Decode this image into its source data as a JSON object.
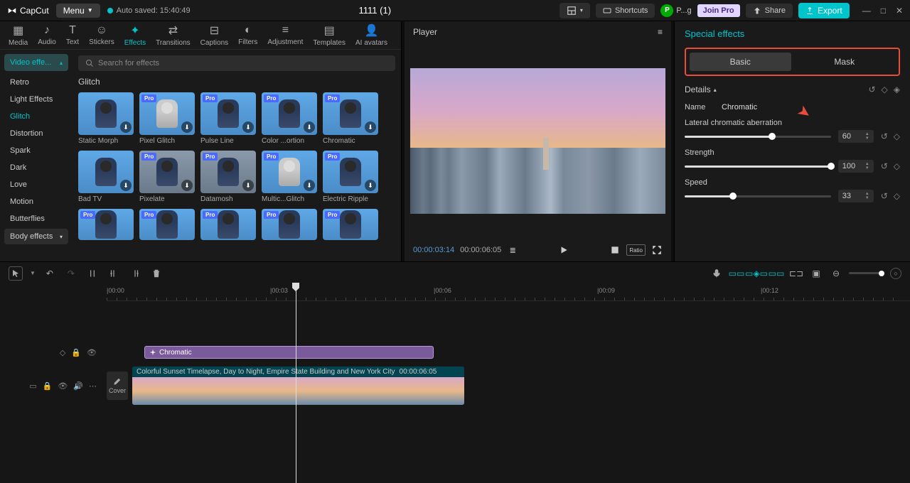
{
  "app": {
    "name": "CapCut",
    "menu": "Menu",
    "autosave": "Auto saved: 15:40:49",
    "project": "1111 (1)"
  },
  "top": {
    "shortcuts": "Shortcuts",
    "user": "P...g",
    "user_initial": "P",
    "join": "Join Pro",
    "share": "Share",
    "export": "Export"
  },
  "nav": [
    "Media",
    "Audio",
    "Text",
    "Stickers",
    "Effects",
    "Transitions",
    "Captions",
    "Filters",
    "Adjustment",
    "Templates",
    "AI avatars"
  ],
  "sidebar": {
    "header": "Video effe...",
    "items": [
      "Retro",
      "Light Effects",
      "Glitch",
      "Distortion",
      "Spark",
      "Dark",
      "Love",
      "Motion",
      "Butterflies"
    ],
    "active": "Glitch",
    "body": "Body effects"
  },
  "search": {
    "placeholder": "Search for effects"
  },
  "section": "Glitch",
  "effects": [
    {
      "label": "Static Morph",
      "pro": false
    },
    {
      "label": "Pixel Glitch",
      "pro": true
    },
    {
      "label": "Pulse Line",
      "pro": true
    },
    {
      "label": "Color ...ortion",
      "pro": true
    },
    {
      "label": "Chromatic",
      "pro": true
    },
    {
      "label": "Bad TV",
      "pro": false
    },
    {
      "label": "Pixelate",
      "pro": true
    },
    {
      "label": "Datamosh",
      "pro": true
    },
    {
      "label": "Multic...Glitch",
      "pro": true
    },
    {
      "label": "Electric Ripple",
      "pro": true
    }
  ],
  "player": {
    "title": "Player",
    "cur": "00:00:03:14",
    "dur": "00:00:06:05",
    "ratio": "Ratio"
  },
  "rp": {
    "title": "Special effects",
    "tabs": [
      "Basic",
      "Mask"
    ],
    "details": "Details",
    "name_lbl": "Name",
    "name_val": "Chromatic",
    "p1": {
      "label": "Lateral chromatic aberration",
      "val": "60",
      "pct": 60
    },
    "p2": {
      "label": "Strength",
      "val": "100",
      "pct": 100
    },
    "p3": {
      "label": "Speed",
      "val": "33",
      "pct": 33
    }
  },
  "ruler": [
    "|00:00",
    "|00:03",
    "|00:06",
    "|00:09",
    "|00:12"
  ],
  "timeline": {
    "effect_name": "Chromatic",
    "clip_name": "Colorful Sunset Timelapse, Day to Night, Empire State Building and New York City",
    "clip_dur": "00:00:06:05",
    "cover": "Cover"
  }
}
